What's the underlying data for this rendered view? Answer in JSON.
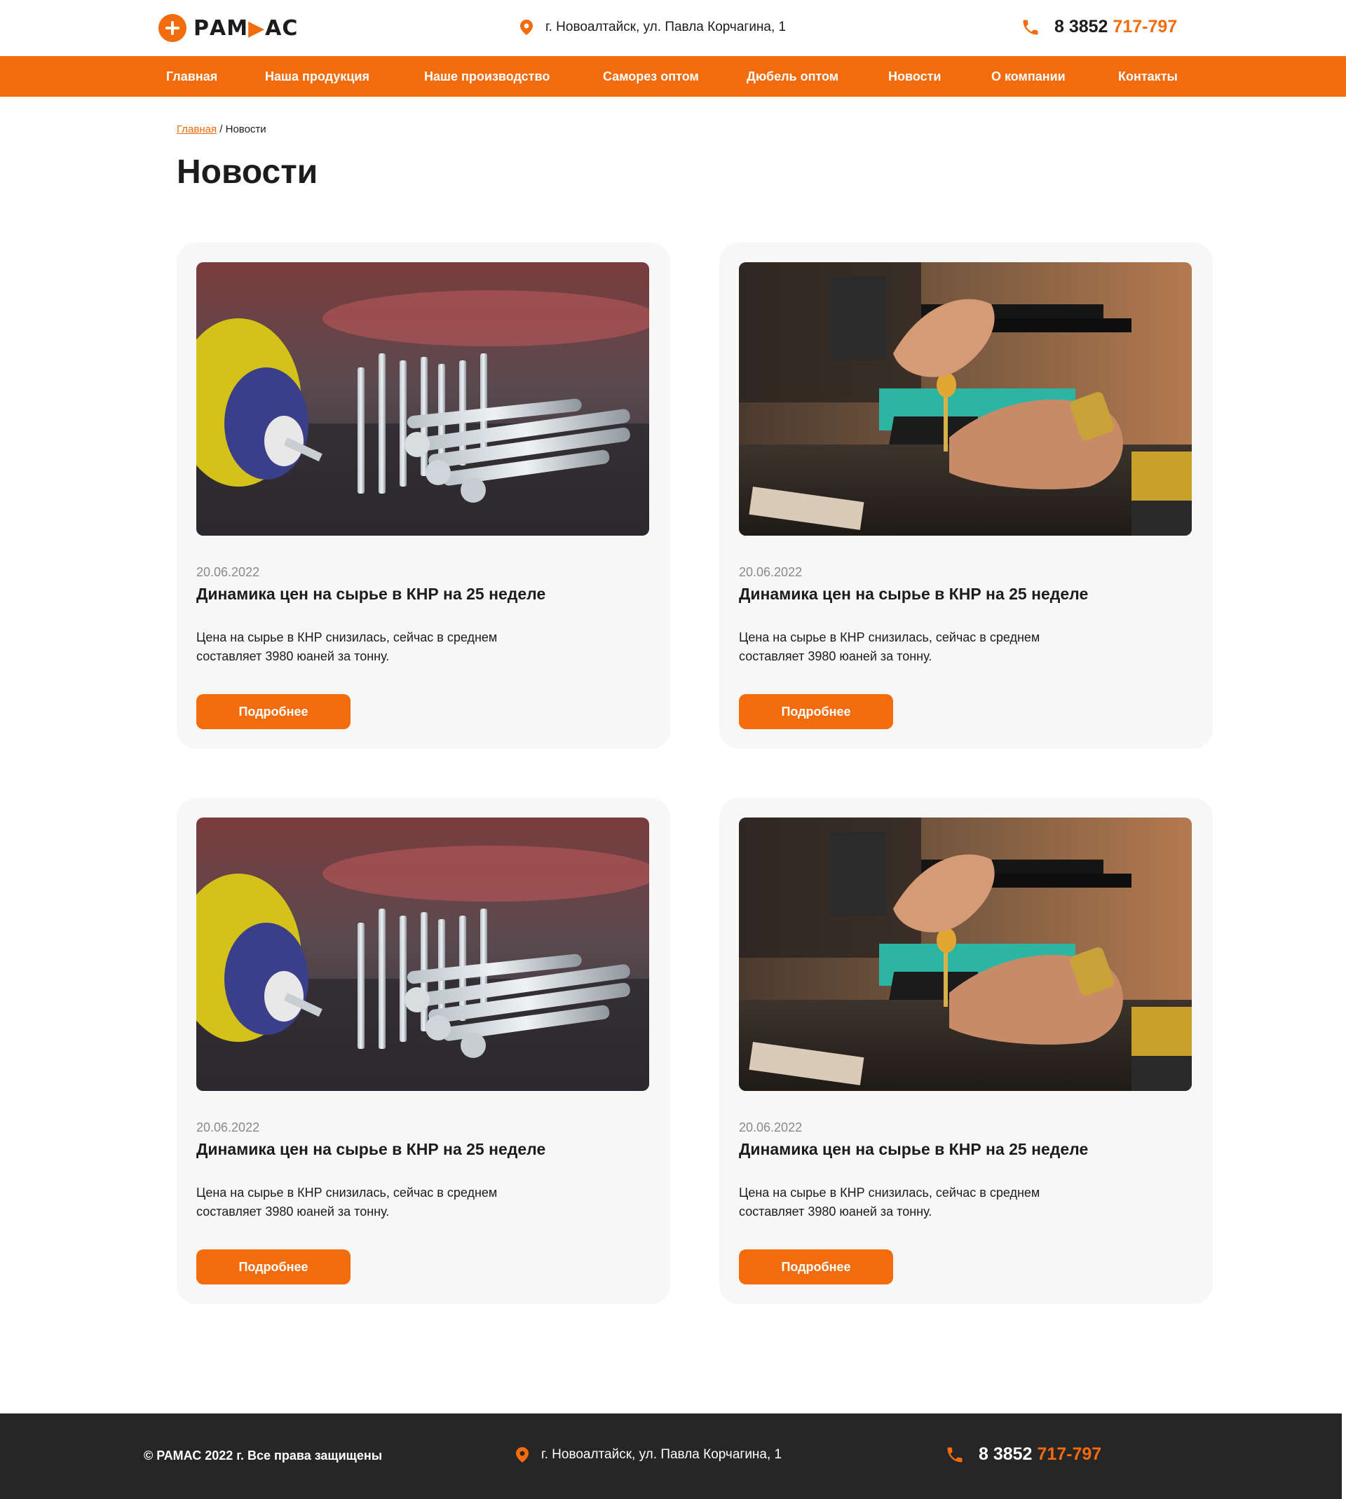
{
  "brand": {
    "logo_text_part1": "РАМ",
    "logo_text_part2": "АС",
    "accent_color": "#f26b0c",
    "dark_color": "#262626"
  },
  "header": {
    "address": "г. Новоалтайск, ул. Павла Корчагина, 1",
    "phone_prefix": "8 3852",
    "phone_number": "717-797"
  },
  "nav": {
    "items": [
      {
        "label": "Главная"
      },
      {
        "label": "Наша продукция"
      },
      {
        "label": "Наше производство"
      },
      {
        "label": "Саморез оптом"
      },
      {
        "label": "Дюбель оптом"
      },
      {
        "label": "Новости"
      },
      {
        "label": "О компании"
      },
      {
        "label": "Контакты"
      }
    ]
  },
  "breadcrumb": {
    "home": "Главная",
    "separator": " / ",
    "current": "Новости"
  },
  "page": {
    "title": "Новости"
  },
  "news": [
    {
      "image": "screws-photo",
      "date": "20.06.2022",
      "title": "Динамика цен на сырье в КНР на 25 неделе",
      "text": "Цена на сырье в КНР снизилась, сейчас в среднем составляет 3980 юаней за тонну.",
      "button": "Подробнее"
    },
    {
      "image": "workshop-photo",
      "date": "20.06.2022",
      "title": "Динамика цен на сырье в КНР на 25 неделе",
      "text": "Цена на сырье в КНР снизилась, сейчас в среднем составляет 3980 юаней за тонну.",
      "button": "Подробнее"
    },
    {
      "image": "screws-photo",
      "date": "20.06.2022",
      "title": "Динамика цен на сырье в КНР на 25 неделе",
      "text": "Цена на сырье в КНР снизилась, сейчас в среднем составляет 3980 юаней за тонну.",
      "button": "Подробнее"
    },
    {
      "image": "workshop-photo",
      "date": "20.06.2022",
      "title": "Динамика цен на сырье в КНР на 25 неделе",
      "text": "Цена на сырье в КНР снизилась, сейчас в среднем составляет 3980 юаней за тонну.",
      "button": "Подробнее"
    }
  ],
  "footer": {
    "copyright": "© РАМАС 2022 г. Все права защищены",
    "address": "г. Новоалтайск, ул. Павла Корчагина, 1",
    "phone_prefix": "8 3852",
    "phone_number": "717-797"
  }
}
